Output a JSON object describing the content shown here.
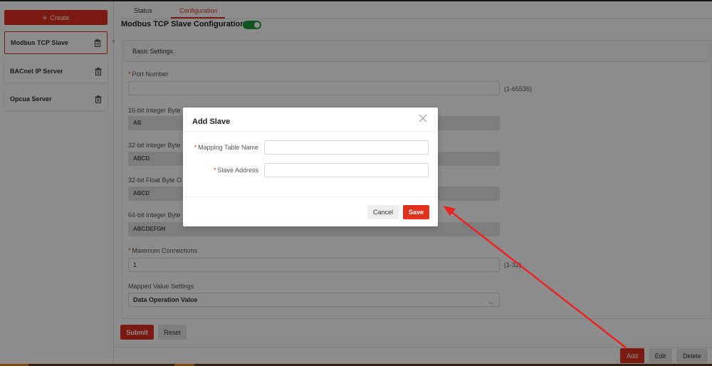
{
  "sidebar": {
    "create_label": "Create",
    "items": [
      {
        "label": "Modbus TCP Slave"
      },
      {
        "label": "BACnet IP Server"
      },
      {
        "label": "Opcua Server"
      }
    ]
  },
  "tabs": [
    {
      "label": "Status"
    },
    {
      "label": "Configuration"
    }
  ],
  "page": {
    "title": "Modbus TCP Slave Configuration",
    "enabled": true
  },
  "form": {
    "section_title": "Basic Settings",
    "port": {
      "label": "Port Number",
      "value": "-",
      "hint": "(1-65535)"
    },
    "int16_order": {
      "label": "16-bit Integer Byte",
      "value": "AB"
    },
    "int32_order": {
      "label": "32-bit Integer Byte",
      "value": "ABCD"
    },
    "float32_order": {
      "label": "32-bit Float Byte O",
      "value": "ABCD"
    },
    "int64_order": {
      "label": "64-bit Integer Byte",
      "value": "ABCDEFGH"
    },
    "max_connections": {
      "label": "Maximum Connections",
      "value": "1",
      "hint": "(1-32)"
    },
    "mapped_value": {
      "label": "Mapped Value Settings",
      "value": "Data Operation Value"
    },
    "submit_label": "Submit",
    "reset_label": "Reset"
  },
  "footer": {
    "add_label": "Add",
    "edit_label": "Edit",
    "delete_label": "Delete"
  },
  "modal": {
    "title": "Add Slave",
    "mapping_table_label": "Mapping Table Name",
    "mapping_table_value": "",
    "slave_address_label": "Slave Address",
    "slave_address_value": "",
    "cancel_label": "Cancel",
    "save_label": "Save"
  },
  "colors": {
    "accent": "#e0301e",
    "toggle_on": "#1f9a3a",
    "annotation_arrow": "#ee2020"
  }
}
